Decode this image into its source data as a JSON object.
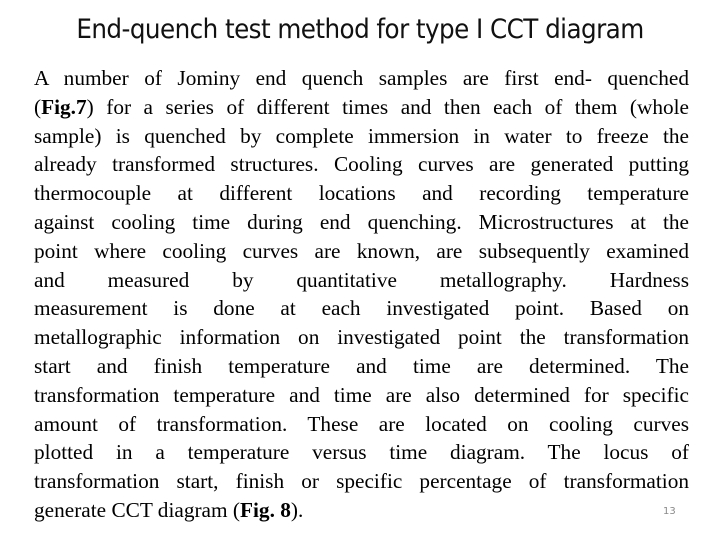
{
  "slide": {
    "title": "End-quench test method for type I CCT diagram",
    "page_number": "13",
    "body_lines": [
      {
        "segments": [
          {
            "text": "A number of Jominy end quench samples are first end- quenched",
            "bold": false
          }
        ]
      },
      {
        "segments": [
          {
            "text": "(",
            "bold": false
          },
          {
            "text": "Fig.7",
            "bold": true
          },
          {
            "text": ") for a series of different times  and then each of them (whole",
            "bold": false
          }
        ]
      },
      {
        "segments": [
          {
            "text": "sample) is  quenched by complete immersion in water to freeze the",
            "bold": false
          }
        ]
      },
      {
        "segments": [
          {
            "text": "already transformed structures. Cooling curves are generated putting",
            "bold": false
          }
        ]
      },
      {
        "segments": [
          {
            "text": "thermocouple at different locations and recording temperature",
            "bold": false
          }
        ]
      },
      {
        "segments": [
          {
            "text": "against cooling time during end quenching. Microstructures at the",
            "bold": false
          }
        ]
      },
      {
        "segments": [
          {
            "text": "point where cooling curves are known, are subsequently examined",
            "bold": false
          }
        ]
      },
      {
        "segments": [
          {
            "text": "and measured by quantitative metallography. Hardness",
            "bold": false
          }
        ]
      },
      {
        "segments": [
          {
            "text": "measurement is done at each investigated point. Based on",
            "bold": false
          }
        ]
      },
      {
        "segments": [
          {
            "text": "metallographic information on investigated point the transformation",
            "bold": false
          }
        ]
      },
      {
        "segments": [
          {
            "text": "start and finish temperature and time are determined. The",
            "bold": false
          }
        ]
      },
      {
        "segments": [
          {
            "text": "transformation temperature and time are also determined for specific",
            "bold": false
          }
        ]
      },
      {
        "segments": [
          {
            "text": "amount of transformation. These are located on cooling curves",
            "bold": false
          }
        ]
      },
      {
        "segments": [
          {
            "text": "plotted in a temperature versus time diagram. The locus of",
            "bold": false
          }
        ]
      },
      {
        "segments": [
          {
            "text": "transformation start, finish or specific percentage of transformation",
            "bold": false
          }
        ]
      },
      {
        "segments": [
          {
            "text": "generate CCT diagram (",
            "bold": false
          },
          {
            "text": "Fig. 8",
            "bold": true
          },
          {
            "text": ").",
            "bold": false
          }
        ],
        "last": true
      }
    ]
  }
}
